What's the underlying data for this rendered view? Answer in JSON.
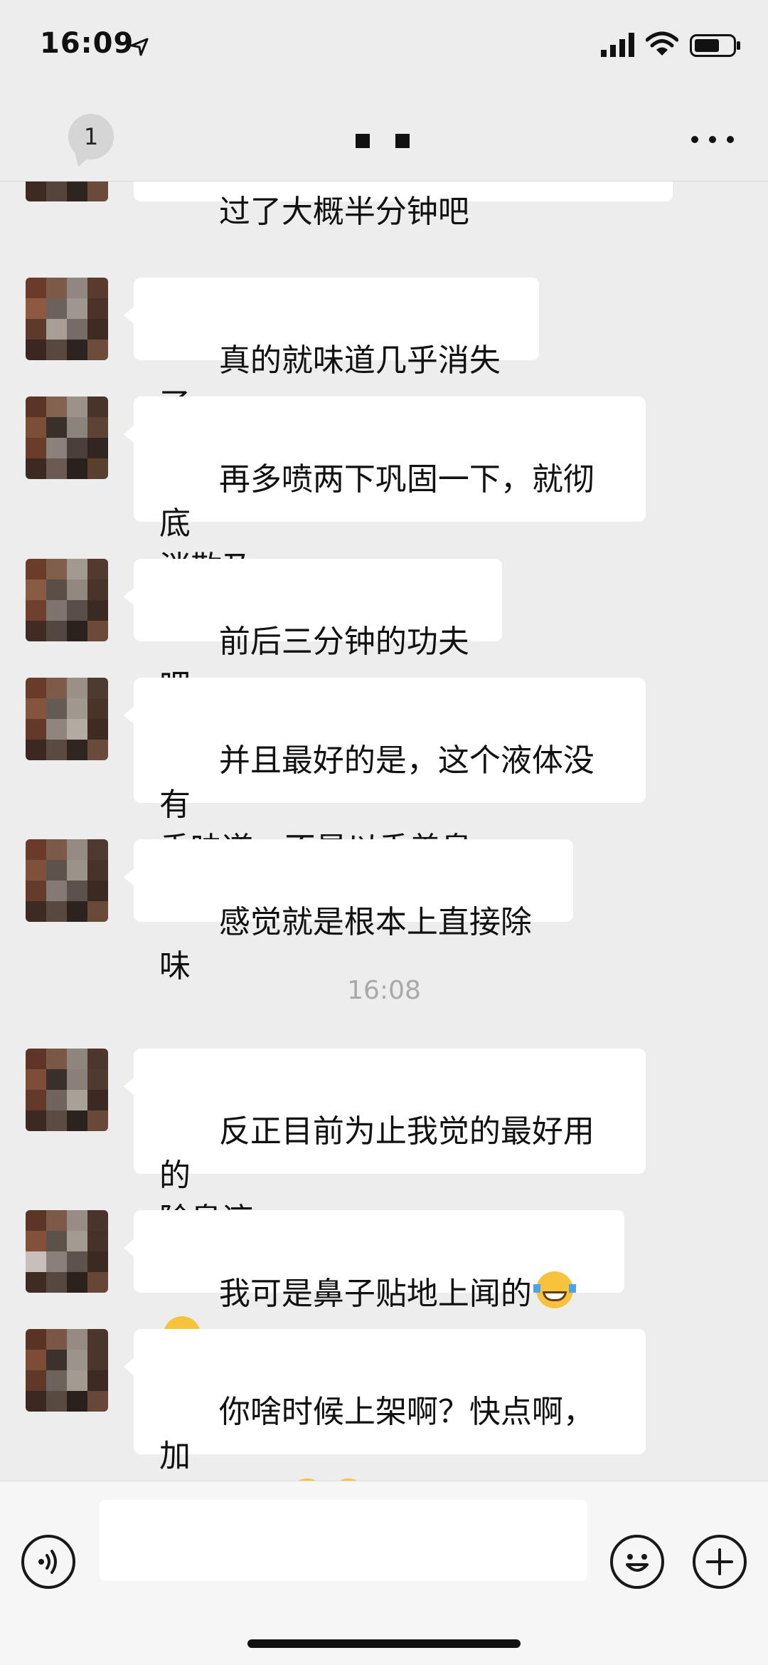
{
  "status_bar": {
    "time": "16:09"
  },
  "header": {
    "unread_count": "1"
  },
  "chat": {
    "messages": [
      {
        "text": "过了大概半分钟吧"
      },
      {
        "text": "真的就味道几乎消失了"
      },
      {
        "text": "再多喷两下巩固一下，就彻底\n消散乃"
      },
      {
        "text": "前后三分钟的功夫吧"
      },
      {
        "text": "并且最好的是，这个液体没有\n香味道，不是以香盖臭"
      },
      {
        "text": "感觉就是根本上直接除味"
      },
      {
        "text": "反正目前为止我觉的最好用的\n除臭液"
      },
      {
        "text": "我可是鼻子贴地上闻的",
        "emoji_icons": [
          "face-with-tears-of-joy-icon",
          "face-with-tears-of-joy-icon"
        ]
      },
      {
        "text": "你啥时候上架啊？快点啊，加\n快点速度",
        "emoji_icons": [
          "grinning-face-icon",
          "grinning-face-icon"
        ]
      }
    ],
    "timestamp": "16:08"
  },
  "input": {
    "value": "",
    "placeholder": ""
  },
  "icons": {
    "voice": "voice-icon",
    "emoji": "emoji-icon",
    "plus": "plus-icon",
    "more": "more-icon"
  }
}
